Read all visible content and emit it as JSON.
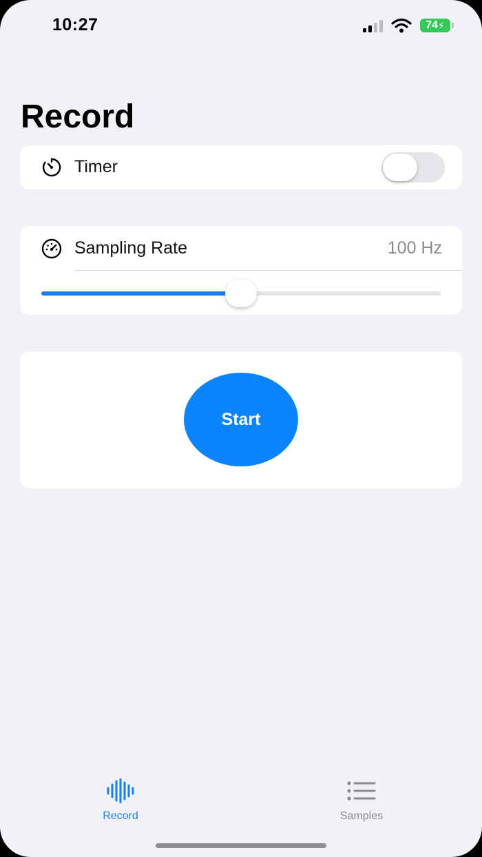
{
  "status_bar": {
    "time": "10:27",
    "battery_level": "74",
    "battery_color": "#34c759"
  },
  "page": {
    "title": "Record"
  },
  "timer": {
    "label": "Timer",
    "icon": "timer-icon",
    "enabled": false
  },
  "sampling_rate": {
    "label": "Sampling Rate",
    "icon": "speedometer-icon",
    "value_text": "100 Hz",
    "slider_fraction": 0.5
  },
  "start": {
    "label": "Start",
    "color": "#0a84ff"
  },
  "tab_bar": {
    "items": [
      {
        "label": "Record",
        "icon": "waveform-icon",
        "selected": true
      },
      {
        "label": "Samples",
        "icon": "list-icon",
        "selected": false
      }
    ],
    "accent_color": "#1a7fe8"
  }
}
